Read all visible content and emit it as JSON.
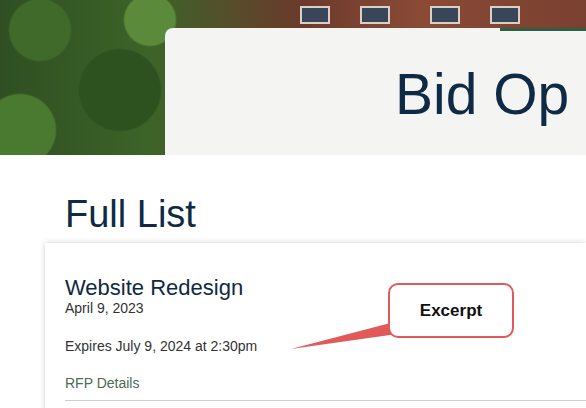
{
  "hero": {
    "title": "Bid Op"
  },
  "section": {
    "title": "Full List"
  },
  "items": [
    {
      "title": "Website Redesign",
      "date": "April 9, 2023",
      "excerpt": "Expires July 9, 2024 at 2:30pm",
      "link": "RFP Details"
    }
  ],
  "annotation": {
    "label": "Excerpt"
  }
}
